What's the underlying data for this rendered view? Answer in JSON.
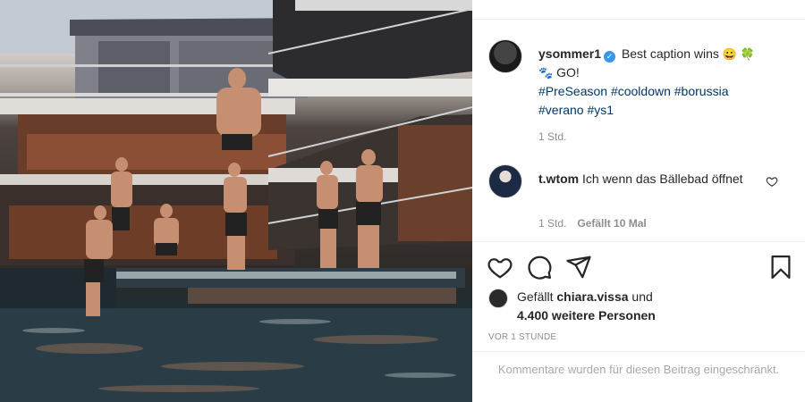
{
  "post": {
    "username": "ysommer1",
    "caption_text": "Best caption wins",
    "caption_emoji": "😀 🍀",
    "caption_line2_emoji": "🐾",
    "caption_go": "GO!",
    "hashtags_line1": "#PreSeason #cooldown #borussia",
    "hashtags_line2": "#verano #ys1",
    "time": "1 Std."
  },
  "comment": {
    "username": "t.wtom",
    "text": "Ich wenn das Bällebad öffnet",
    "time": "1 Std.",
    "likes_label": "Gefällt 10 Mal"
  },
  "likes": {
    "prefix": "Gefällt",
    "liker": "chiara.vissa",
    "connector": "und",
    "others": "4.400 weitere Personen"
  },
  "post_date": "VOR 1 STUNDE",
  "comments_restricted": "Kommentare wurden für diesen Beitrag eingeschränkt.",
  "icons": [
    "heart-icon",
    "comment-icon",
    "share-icon",
    "bookmark-icon",
    "verified-badge-icon"
  ],
  "colors": {
    "hashtag": "#00376b",
    "verified": "#3897f0",
    "muted": "#8e8e8e"
  }
}
